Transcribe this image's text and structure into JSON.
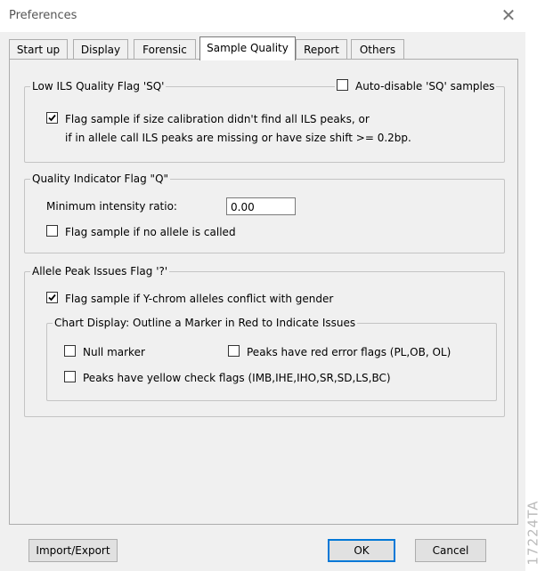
{
  "window": {
    "title": "Preferences"
  },
  "tabs": [
    {
      "label": "Start up"
    },
    {
      "label": "Display"
    },
    {
      "label": "Forensic"
    },
    {
      "label": "Sample Quality"
    },
    {
      "label": "Report"
    },
    {
      "label": "Others"
    }
  ],
  "active_tab": "Sample Quality",
  "low_ils": {
    "legend": "Low ILS Quality Flag 'SQ'",
    "auto_disable": {
      "label": "Auto-disable 'SQ' samples",
      "checked": false
    },
    "flag_size_cal": {
      "line1": "Flag sample if size calibration didn't find all ILS peaks, or",
      "line2": "if in allele call ILS peaks are missing or have size shift >= 0.2bp.",
      "checked": true
    }
  },
  "quality_indicator": {
    "legend": "Quality Indicator Flag \"Q\"",
    "min_intensity_label": "Minimum intensity ratio:",
    "min_intensity_value": "0.00",
    "no_allele": {
      "label": "Flag sample if no allele is called",
      "checked": false
    }
  },
  "allele_peak": {
    "legend": "Allele Peak Issues Flag '?'",
    "y_chrom": {
      "label": "Flag sample if Y-chrom alleles conflict with gender",
      "checked": true
    },
    "chart_display": {
      "legend": "Chart Display: Outline a Marker in Red to Indicate Issues",
      "null_marker": {
        "label": "Null marker",
        "checked": false
      },
      "red_flags": {
        "label": "Peaks have red error flags (PL,OB, OL)",
        "checked": false
      },
      "yellow_flags": {
        "label": "Peaks have yellow check flags (IMB,IHE,IHO,SR,SD,LS,BC)",
        "checked": false
      }
    }
  },
  "footer": {
    "import_export": "Import/Export",
    "ok": "OK",
    "cancel": "Cancel"
  },
  "watermark": "17224TA",
  "colors": {
    "dialog_bg": "#f0f0f0",
    "border": "#adadad",
    "group_border": "#c4c4c4"
  }
}
